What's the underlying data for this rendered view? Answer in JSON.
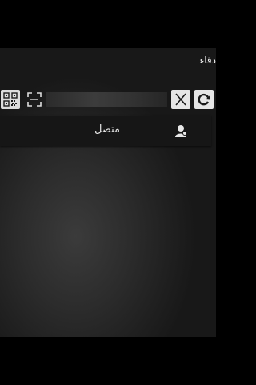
{
  "header": {
    "title": "دقاء"
  },
  "toolbar": {
    "search_value": "",
    "icons": {
      "qr": "qr-code-icon",
      "scan": "scan-frame-icon",
      "clear": "close-x-icon",
      "refresh": "refresh-icon"
    }
  },
  "contacts": [
    {
      "status": "متصل",
      "avatar_icon": "user-avatar-icon"
    }
  ],
  "colors": {
    "panel": "#2c2c2c",
    "row_background": "#161616",
    "text": "#e4e4e4",
    "button_face": "#e6e6e6"
  }
}
